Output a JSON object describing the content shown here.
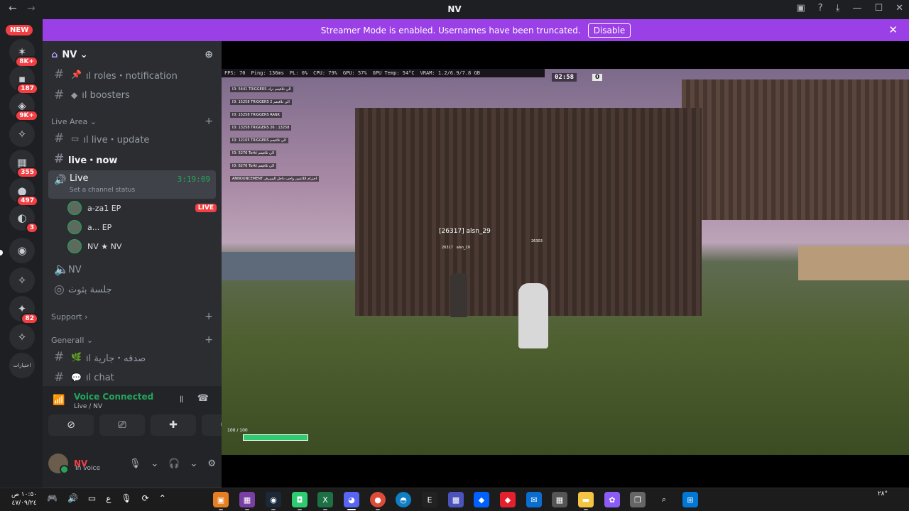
{
  "window": {
    "title": "NV"
  },
  "banner": {
    "text": "Streamer Mode is enabled. Usernames have been truncated.",
    "button": "Disable"
  },
  "servers": {
    "new_label": "NEW",
    "badges": [
      "8K+",
      "187",
      "9K+",
      "355",
      "497",
      "3",
      "82"
    ],
    "last_label": "اختيارات"
  },
  "server_header": {
    "name": "NV"
  },
  "channels": {
    "roles": "ıl roles・notification",
    "boosters": "ıl boosters",
    "cat_live": "Live Area",
    "live_update": "ıl live・update",
    "live_now": "live・now",
    "live_voice": "Live",
    "live_timer": "3:19:09",
    "live_status": "Set a channel status",
    "nv_voice": "NV",
    "stage": "جلسة بثوث",
    "cat_support": "Support",
    "cat_general": "Generall",
    "sadaqa": "ıl صدقه・جارية",
    "chat": "ıl chat"
  },
  "voice_users": [
    {
      "name": "a-za1",
      "tag": "EP",
      "live": "LIVE"
    },
    {
      "name": "a...",
      "tag": "EP",
      "live": ""
    },
    {
      "name": "NV ★",
      "tag": "NV",
      "live": ""
    }
  ],
  "voice_panel": {
    "status": "Voice Connected",
    "location": "Live / NV"
  },
  "user": {
    "name": "NV",
    "status": "In voice"
  },
  "game": {
    "hud": [
      "FPS: 70",
      "Ping: 136ms",
      "PL: 0%",
      "CPU: 79%",
      "GPU: 57%",
      "GPU Temp: 54°C",
      "VRAM: 1.2/6.9/7.8 GB"
    ],
    "timer": "02:58",
    "round": "0",
    "player_tag": "[26317] alsn_29",
    "sub_id": "26317",
    "sub_name": "alsn_29",
    "other_id": "26303",
    "health": "100 / 100",
    "killfeed": [
      "ID: 5441 TRIGGERS الي تلاقيعم ترك",
      "ID: 15258 TRIGGERS الي تلاقيعم 2",
      "ID: 15258 TRIGGERS RANK",
      "ID: 13258 TRIGGERS 26 : 13258",
      "ID: 12105 TRIGGERS الي تلاقيعم",
      "ID: 5276 Turki الي تلاقيعم",
      "ID: 6276 Turki الي تلاقيعم",
      "ANNOUNCEMENT احترام اللاعبين واجب داخل السيرفر"
    ]
  },
  "taskbar": {
    "time": "١٠:٥٠ ص",
    "date": "٤٧/٠٩/٢٤",
    "lang": "ع",
    "tray_right": "٢٨°"
  }
}
